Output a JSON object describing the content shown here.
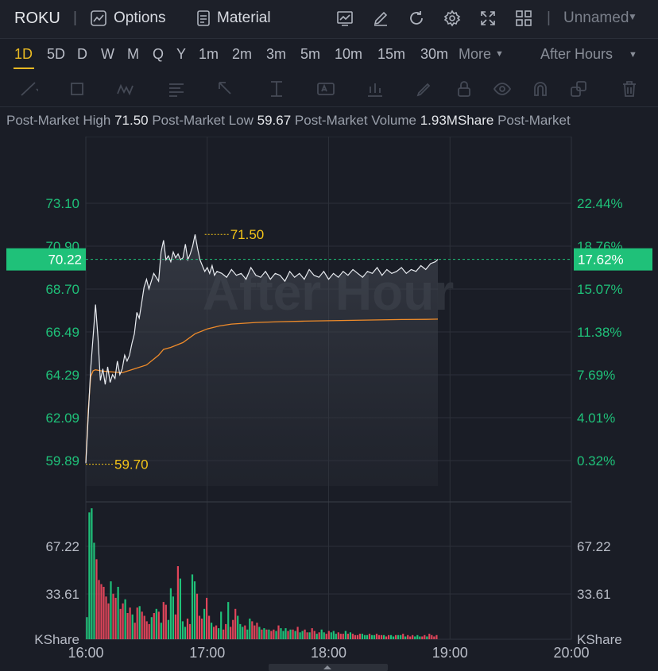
{
  "header": {
    "symbol": "ROKU",
    "options_label": "Options",
    "material_label": "Material",
    "layout_name": "Unnamed"
  },
  "timeframes": {
    "items": [
      "1D",
      "5D",
      "D",
      "W",
      "M",
      "Q",
      "Y",
      "1m",
      "2m",
      "3m",
      "5m",
      "10m",
      "15m",
      "30m",
      "More"
    ],
    "active": "1D",
    "session": "After Hours"
  },
  "stats": {
    "high_label": "Post-Market High",
    "high_value": "71.50",
    "low_label": "Post-Market Low",
    "low_value": "59.67",
    "volume_label": "Post-Market Volume",
    "volume_value": "1.93MShare",
    "trailing_label": "Post-Market"
  },
  "colors": {
    "up": "#1fc179",
    "down": "#e0455a",
    "price_line": "#e9ecf1",
    "avg_line": "#f08c2a",
    "marker": "#f5c518",
    "accent": "#e8b923"
  },
  "chart_data": {
    "type": "line",
    "watermark": "After Hour",
    "current_price": "70.22",
    "current_pct": "17.62%",
    "y_left_ticks": [
      "73.10",
      "70.90",
      "68.70",
      "66.49",
      "64.29",
      "62.09",
      "59.89"
    ],
    "y_right_ticks": [
      "22.44%",
      "18.76%",
      "15.07%",
      "11.38%",
      "7.69%",
      "4.01%",
      "0.32%"
    ],
    "x_ticks": [
      "16:00",
      "17:00",
      "18:00",
      "19:00",
      "20:00"
    ],
    "ylim": [
      59.89,
      73.1
    ],
    "high_marker": {
      "time": 0.98,
      "value": 71.5,
      "label": "71.50"
    },
    "low_marker": {
      "time": 0.0,
      "value": 59.7,
      "label": "59.70"
    },
    "price_series": {
      "name": "price",
      "t": [
        0.0,
        0.04,
        0.08,
        0.1,
        0.12,
        0.14,
        0.16,
        0.18,
        0.2,
        0.22,
        0.24,
        0.26,
        0.28,
        0.3,
        0.32,
        0.34,
        0.36,
        0.38,
        0.4,
        0.42,
        0.44,
        0.46,
        0.48,
        0.5,
        0.52,
        0.56,
        0.6,
        0.62,
        0.64,
        0.66,
        0.68,
        0.7,
        0.72,
        0.74,
        0.76,
        0.78,
        0.8,
        0.82,
        0.84,
        0.86,
        0.88,
        0.9,
        0.92,
        0.94,
        0.96,
        0.98,
        1.0,
        1.02,
        1.04,
        1.06,
        1.08,
        1.12,
        1.16,
        1.2,
        1.24,
        1.28,
        1.32,
        1.36,
        1.4,
        1.44,
        1.48,
        1.52,
        1.56,
        1.6,
        1.64,
        1.68,
        1.72,
        1.76,
        1.8,
        1.84,
        1.88,
        1.92,
        1.96,
        2.0,
        2.04,
        2.08,
        2.12,
        2.16,
        2.2,
        2.24,
        2.28,
        2.32,
        2.36,
        2.4,
        2.44,
        2.48,
        2.52,
        2.56,
        2.6,
        2.64,
        2.68,
        2.72,
        2.76,
        2.8,
        2.84,
        2.88,
        2.9
      ],
      "v": [
        59.75,
        64.6,
        67.9,
        66.2,
        64.0,
        64.6,
        63.8,
        64.7,
        63.9,
        64.3,
        64.1,
        65.0,
        64.3,
        64.6,
        65.3,
        65.0,
        65.3,
        65.9,
        66.4,
        67.5,
        67.2,
        68.0,
        68.8,
        69.2,
        68.7,
        69.5,
        69.1,
        70.6,
        71.2,
        70.2,
        70.4,
        70.1,
        70.6,
        70.3,
        70.5,
        70.2,
        70.3,
        71.0,
        70.2,
        70.5,
        70.9,
        71.5,
        70.8,
        70.2,
        69.9,
        69.6,
        69.8,
        69.5,
        69.9,
        69.4,
        69.6,
        69.5,
        69.3,
        69.7,
        69.4,
        69.5,
        69.2,
        69.8,
        69.4,
        69.3,
        69.6,
        69.2,
        69.5,
        69.4,
        69.1,
        69.6,
        69.3,
        69.5,
        69.2,
        69.7,
        69.4,
        69.3,
        69.6,
        69.2,
        69.5,
        69.3,
        69.6,
        69.4,
        69.7,
        69.5,
        69.3,
        69.6,
        69.5,
        69.8,
        69.4,
        69.7,
        69.5,
        69.6,
        69.8,
        69.5,
        69.7,
        69.6,
        69.9,
        69.7,
        70.0,
        70.1,
        70.22
      ]
    },
    "avg_series": {
      "name": "average",
      "t": [
        0.0,
        0.02,
        0.04,
        0.06,
        0.08,
        0.12,
        0.2,
        0.3,
        0.4,
        0.5,
        0.6,
        0.64,
        0.7,
        0.8,
        0.9,
        1.0,
        1.1,
        1.2,
        1.4,
        1.6,
        1.8,
        2.0,
        2.2,
        2.4,
        2.6,
        2.8,
        2.9
      ],
      "v": [
        59.8,
        62.5,
        64.2,
        64.5,
        64.55,
        64.5,
        64.45,
        64.4,
        64.6,
        64.8,
        65.3,
        65.6,
        65.7,
        65.95,
        66.4,
        66.65,
        66.8,
        66.9,
        66.98,
        67.02,
        67.05,
        67.07,
        67.09,
        67.11,
        67.13,
        67.14,
        67.15
      ]
    },
    "volume_panel": {
      "ylabel": "KShare",
      "y_ticks": [
        "67.22",
        "33.61"
      ],
      "ymax": 93.9,
      "values": [
        16,
        92,
        95,
        70,
        58,
        43,
        40,
        38,
        31,
        26,
        42,
        33,
        30,
        38,
        22,
        26,
        29,
        19,
        23,
        18,
        12,
        23,
        24,
        20,
        17,
        13,
        11,
        16,
        19,
        22,
        20,
        12,
        27,
        25,
        14,
        37,
        31,
        18,
        53,
        44,
        13,
        9,
        15,
        11,
        47,
        42,
        33,
        17,
        15,
        22,
        30,
        17,
        12,
        9,
        10,
        8,
        20,
        7,
        11,
        27,
        9,
        14,
        22,
        17,
        11,
        9,
        10,
        7,
        15,
        13,
        10,
        12,
        9,
        7,
        8,
        7,
        7,
        6,
        7,
        6,
        10,
        8,
        6,
        8,
        6,
        7,
        7,
        6,
        9,
        5,
        6,
        7,
        5,
        5,
        8,
        6,
        4,
        5,
        7,
        5,
        4,
        6,
        5,
        6,
        4,
        5,
        4,
        4,
        6,
        4,
        5,
        4,
        3,
        3,
        4,
        4,
        3,
        3,
        4,
        3,
        3,
        4,
        3,
        3,
        3,
        2,
        3,
        3,
        2,
        3,
        3,
        3,
        4,
        2,
        3,
        2,
        3,
        2,
        3,
        2,
        2,
        3,
        2,
        4,
        3,
        2,
        3
      ],
      "directions": "uuuudddddduddudduddudduddddudududduuudduuudduuddduddudduudduddduuuduudddudududduduuudududuuddudduduudduuudddududddduuuduudddudduuduududdduuudduddd"
    }
  }
}
